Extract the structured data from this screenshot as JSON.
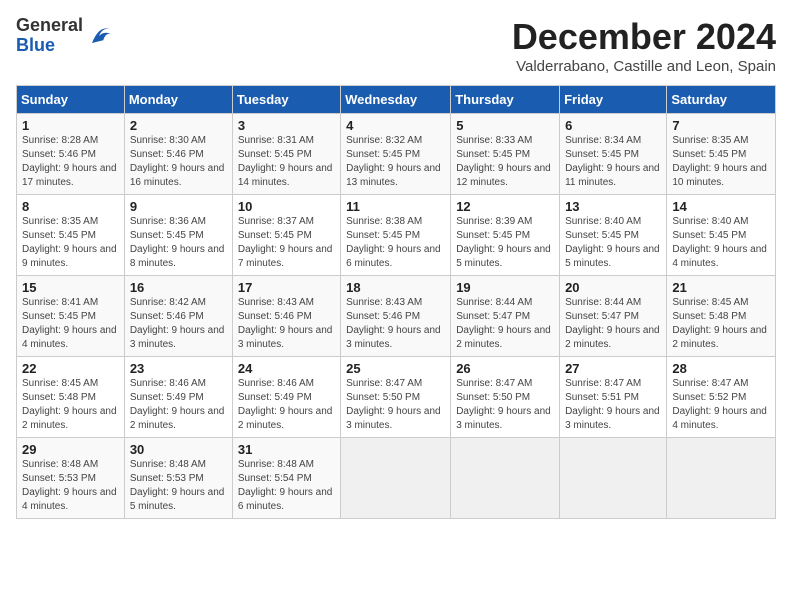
{
  "logo": {
    "general": "General",
    "blue": "Blue"
  },
  "header": {
    "month": "December 2024",
    "location": "Valderrabano, Castille and Leon, Spain"
  },
  "weekdays": [
    "Sunday",
    "Monday",
    "Tuesday",
    "Wednesday",
    "Thursday",
    "Friday",
    "Saturday"
  ],
  "weeks": [
    [
      {
        "day": "1",
        "sunrise": "8:28 AM",
        "sunset": "5:46 PM",
        "daylight": "9 hours and 17 minutes."
      },
      {
        "day": "2",
        "sunrise": "8:30 AM",
        "sunset": "5:46 PM",
        "daylight": "9 hours and 16 minutes."
      },
      {
        "day": "3",
        "sunrise": "8:31 AM",
        "sunset": "5:45 PM",
        "daylight": "9 hours and 14 minutes."
      },
      {
        "day": "4",
        "sunrise": "8:32 AM",
        "sunset": "5:45 PM",
        "daylight": "9 hours and 13 minutes."
      },
      {
        "day": "5",
        "sunrise": "8:33 AM",
        "sunset": "5:45 PM",
        "daylight": "9 hours and 12 minutes."
      },
      {
        "day": "6",
        "sunrise": "8:34 AM",
        "sunset": "5:45 PM",
        "daylight": "9 hours and 11 minutes."
      },
      {
        "day": "7",
        "sunrise": "8:35 AM",
        "sunset": "5:45 PM",
        "daylight": "9 hours and 10 minutes."
      }
    ],
    [
      {
        "day": "8",
        "sunrise": "8:35 AM",
        "sunset": "5:45 PM",
        "daylight": "9 hours and 9 minutes."
      },
      {
        "day": "9",
        "sunrise": "8:36 AM",
        "sunset": "5:45 PM",
        "daylight": "9 hours and 8 minutes."
      },
      {
        "day": "10",
        "sunrise": "8:37 AM",
        "sunset": "5:45 PM",
        "daylight": "9 hours and 7 minutes."
      },
      {
        "day": "11",
        "sunrise": "8:38 AM",
        "sunset": "5:45 PM",
        "daylight": "9 hours and 6 minutes."
      },
      {
        "day": "12",
        "sunrise": "8:39 AM",
        "sunset": "5:45 PM",
        "daylight": "9 hours and 5 minutes."
      },
      {
        "day": "13",
        "sunrise": "8:40 AM",
        "sunset": "5:45 PM",
        "daylight": "9 hours and 5 minutes."
      },
      {
        "day": "14",
        "sunrise": "8:40 AM",
        "sunset": "5:45 PM",
        "daylight": "9 hours and 4 minutes."
      }
    ],
    [
      {
        "day": "15",
        "sunrise": "8:41 AM",
        "sunset": "5:45 PM",
        "daylight": "9 hours and 4 minutes."
      },
      {
        "day": "16",
        "sunrise": "8:42 AM",
        "sunset": "5:46 PM",
        "daylight": "9 hours and 3 minutes."
      },
      {
        "day": "17",
        "sunrise": "8:43 AM",
        "sunset": "5:46 PM",
        "daylight": "9 hours and 3 minutes."
      },
      {
        "day": "18",
        "sunrise": "8:43 AM",
        "sunset": "5:46 PM",
        "daylight": "9 hours and 3 minutes."
      },
      {
        "day": "19",
        "sunrise": "8:44 AM",
        "sunset": "5:47 PM",
        "daylight": "9 hours and 2 minutes."
      },
      {
        "day": "20",
        "sunrise": "8:44 AM",
        "sunset": "5:47 PM",
        "daylight": "9 hours and 2 minutes."
      },
      {
        "day": "21",
        "sunrise": "8:45 AM",
        "sunset": "5:48 PM",
        "daylight": "9 hours and 2 minutes."
      }
    ],
    [
      {
        "day": "22",
        "sunrise": "8:45 AM",
        "sunset": "5:48 PM",
        "daylight": "9 hours and 2 minutes."
      },
      {
        "day": "23",
        "sunrise": "8:46 AM",
        "sunset": "5:49 PM",
        "daylight": "9 hours and 2 minutes."
      },
      {
        "day": "24",
        "sunrise": "8:46 AM",
        "sunset": "5:49 PM",
        "daylight": "9 hours and 2 minutes."
      },
      {
        "day": "25",
        "sunrise": "8:47 AM",
        "sunset": "5:50 PM",
        "daylight": "9 hours and 3 minutes."
      },
      {
        "day": "26",
        "sunrise": "8:47 AM",
        "sunset": "5:50 PM",
        "daylight": "9 hours and 3 minutes."
      },
      {
        "day": "27",
        "sunrise": "8:47 AM",
        "sunset": "5:51 PM",
        "daylight": "9 hours and 3 minutes."
      },
      {
        "day": "28",
        "sunrise": "8:47 AM",
        "sunset": "5:52 PM",
        "daylight": "9 hours and 4 minutes."
      }
    ],
    [
      {
        "day": "29",
        "sunrise": "8:48 AM",
        "sunset": "5:53 PM",
        "daylight": "9 hours and 4 minutes."
      },
      {
        "day": "30",
        "sunrise": "8:48 AM",
        "sunset": "5:53 PM",
        "daylight": "9 hours and 5 minutes."
      },
      {
        "day": "31",
        "sunrise": "8:48 AM",
        "sunset": "5:54 PM",
        "daylight": "9 hours and 6 minutes."
      },
      null,
      null,
      null,
      null
    ]
  ]
}
